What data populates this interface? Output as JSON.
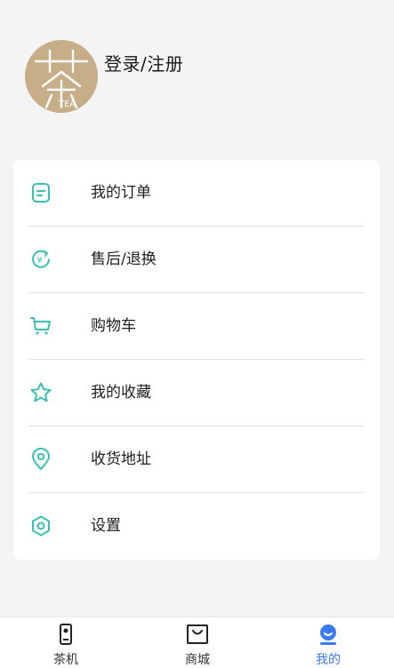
{
  "profile": {
    "login_label": "登录/注册",
    "avatar_text": "TEA"
  },
  "menu": {
    "items": [
      {
        "label": "我的订单",
        "icon": "order-icon"
      },
      {
        "label": "售后/退换",
        "icon": "refund-icon"
      },
      {
        "label": "购物车",
        "icon": "cart-icon"
      },
      {
        "label": "我的收藏",
        "icon": "star-icon"
      },
      {
        "label": "收货地址",
        "icon": "location-icon"
      },
      {
        "label": "设置",
        "icon": "settings-icon"
      }
    ]
  },
  "tabbar": {
    "tabs": [
      {
        "label": "茶机",
        "icon": "tea-machine-icon",
        "active": false
      },
      {
        "label": "商城",
        "icon": "shopping-bag-icon",
        "active": false
      },
      {
        "label": "我的",
        "icon": "profile-icon",
        "active": true
      }
    ]
  },
  "colors": {
    "accent": "#3bbfb5",
    "tab_active": "#3b7bf0",
    "avatar_bg": "#c8ae88"
  }
}
